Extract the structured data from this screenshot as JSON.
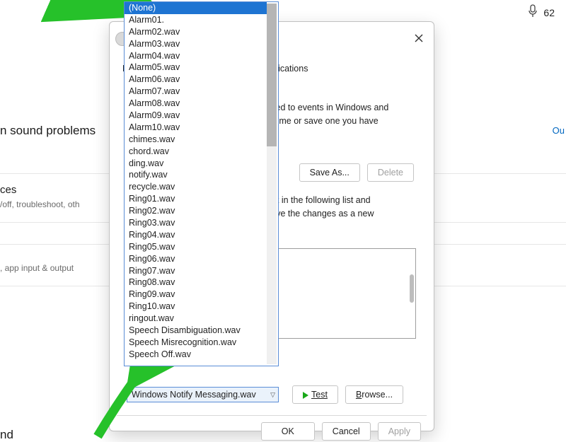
{
  "top_right": {
    "count": "62"
  },
  "background": {
    "heading1": "n sound problems",
    "link_out": "Ou",
    "heading2": "ces",
    "sub2": "/off, troubleshoot, oth",
    "sub3": ", app input & output",
    "heading4": "nd"
  },
  "dialog": {
    "tab_left_fragment": "Pla",
    "tab_right_fragment": "ications",
    "desc1_a": "plied to events in Windows and",
    "desc1_b": "theme or save one you have",
    "save_as": "Save As...",
    "delete": "Delete",
    "desc2_a": "ent in the following list and",
    "desc2_b": "save the changes as a new",
    "combo_value": "Windows Notify Messaging.wav",
    "test": "Test",
    "browse": "Browse...",
    "ok": "OK",
    "cancel": "Cancel",
    "apply": "Apply"
  },
  "dropdown": {
    "items": [
      "(None)",
      "Alarm01.",
      "Alarm02.wav",
      "Alarm03.wav",
      "Alarm04.wav",
      "Alarm05.wav",
      "Alarm06.wav",
      "Alarm07.wav",
      "Alarm08.wav",
      "Alarm09.wav",
      "Alarm10.wav",
      "chimes.wav",
      "chord.wav",
      "ding.wav",
      "notify.wav",
      "recycle.wav",
      "Ring01.wav",
      "Ring02.wav",
      "Ring03.wav",
      "Ring04.wav",
      "Ring05.wav",
      "Ring06.wav",
      "Ring07.wav",
      "Ring08.wav",
      "Ring09.wav",
      "Ring10.wav",
      "ringout.wav",
      "Speech Disambiguation.wav",
      "Speech Misrecognition.wav",
      "Speech Off.wav"
    ],
    "selected_index": 0
  }
}
